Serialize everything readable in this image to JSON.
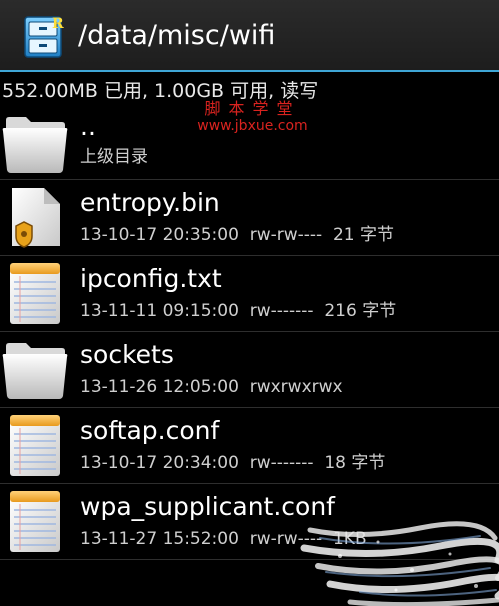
{
  "titlebar": {
    "path": "/data/misc/wifi",
    "icon": "file-cabinet-icon"
  },
  "storage": {
    "info": "552.00MB 已用, 1.00GB 可用, 读写"
  },
  "watermark": {
    "chinese": "脚本学堂",
    "url": "www.jbxue.com"
  },
  "files": [
    {
      "name": "..",
      "meta": "上级目录",
      "icon": "folder-icon"
    },
    {
      "name": "entropy.bin",
      "meta": "13-10-17 20:35:00  rw-rw----  21 字节",
      "icon": "secure-file-icon"
    },
    {
      "name": "ipconfig.txt",
      "meta": "13-11-11 09:15:00  rw-------  216 字节",
      "icon": "text-file-icon"
    },
    {
      "name": "sockets",
      "meta": "13-11-26 12:05:00  rwxrwxrwx",
      "icon": "folder-icon"
    },
    {
      "name": "softap.conf",
      "meta": "13-10-17 20:34:00  rw-------  18 字节",
      "icon": "text-file-icon"
    },
    {
      "name": "wpa_supplicant.conf",
      "meta": "13-11-27 15:52:00  rw-rw----  1KB",
      "icon": "text-file-icon"
    }
  ],
  "colors": {
    "accent": "#3fa6d6",
    "watermark": "#d9231f",
    "background": "#000000"
  }
}
